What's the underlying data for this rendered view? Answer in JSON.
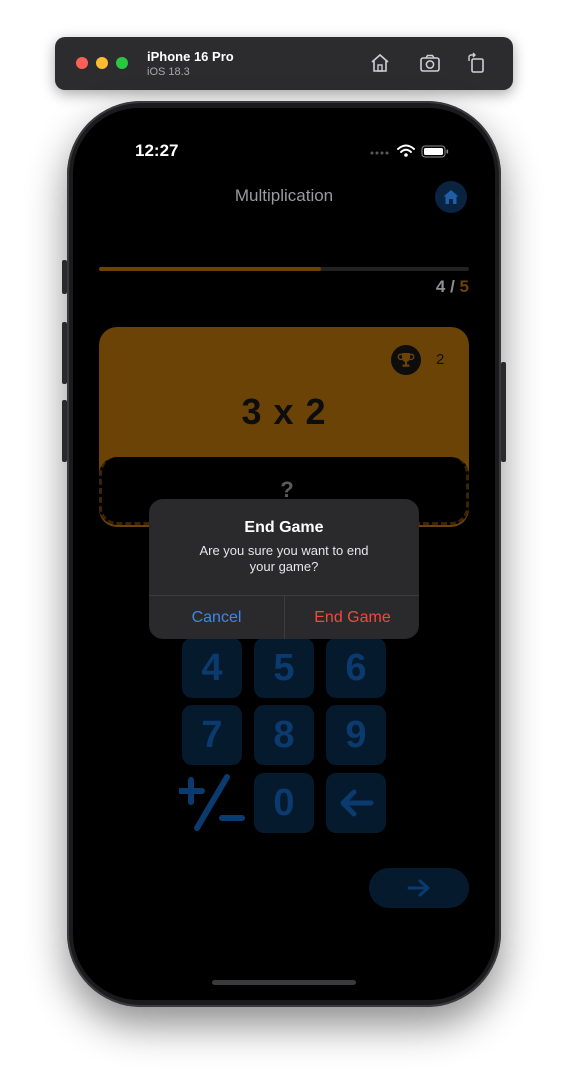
{
  "simulator": {
    "device_name": "iPhone 16 Pro",
    "os_version": "iOS 18.3",
    "icons": [
      "home-icon",
      "screenshot-icon",
      "rotate-icon"
    ]
  },
  "status_bar": {
    "time": "12:27"
  },
  "nav": {
    "title": "Multiplication",
    "home_icon": "house-icon"
  },
  "progress": {
    "current": "4",
    "separator": " / ",
    "total": "5",
    "fraction": 0.6
  },
  "card": {
    "score": "2",
    "question": "3 x 2",
    "answer_placeholder": "?"
  },
  "keypad": {
    "keys": [
      "4",
      "5",
      "6",
      "7",
      "8",
      "9",
      "+/−",
      "0",
      "←"
    ]
  },
  "alert": {
    "title": "End Game",
    "message": "Are you sure you want to end your game?",
    "cancel_label": "Cancel",
    "confirm_label": "End Game"
  },
  "colors": {
    "card": "#6b4306",
    "keypad_text": "#0a3a6e",
    "keypad_bg": "#061a2e",
    "cancel": "#3a87f0",
    "destructive": "#ef4a3e"
  }
}
